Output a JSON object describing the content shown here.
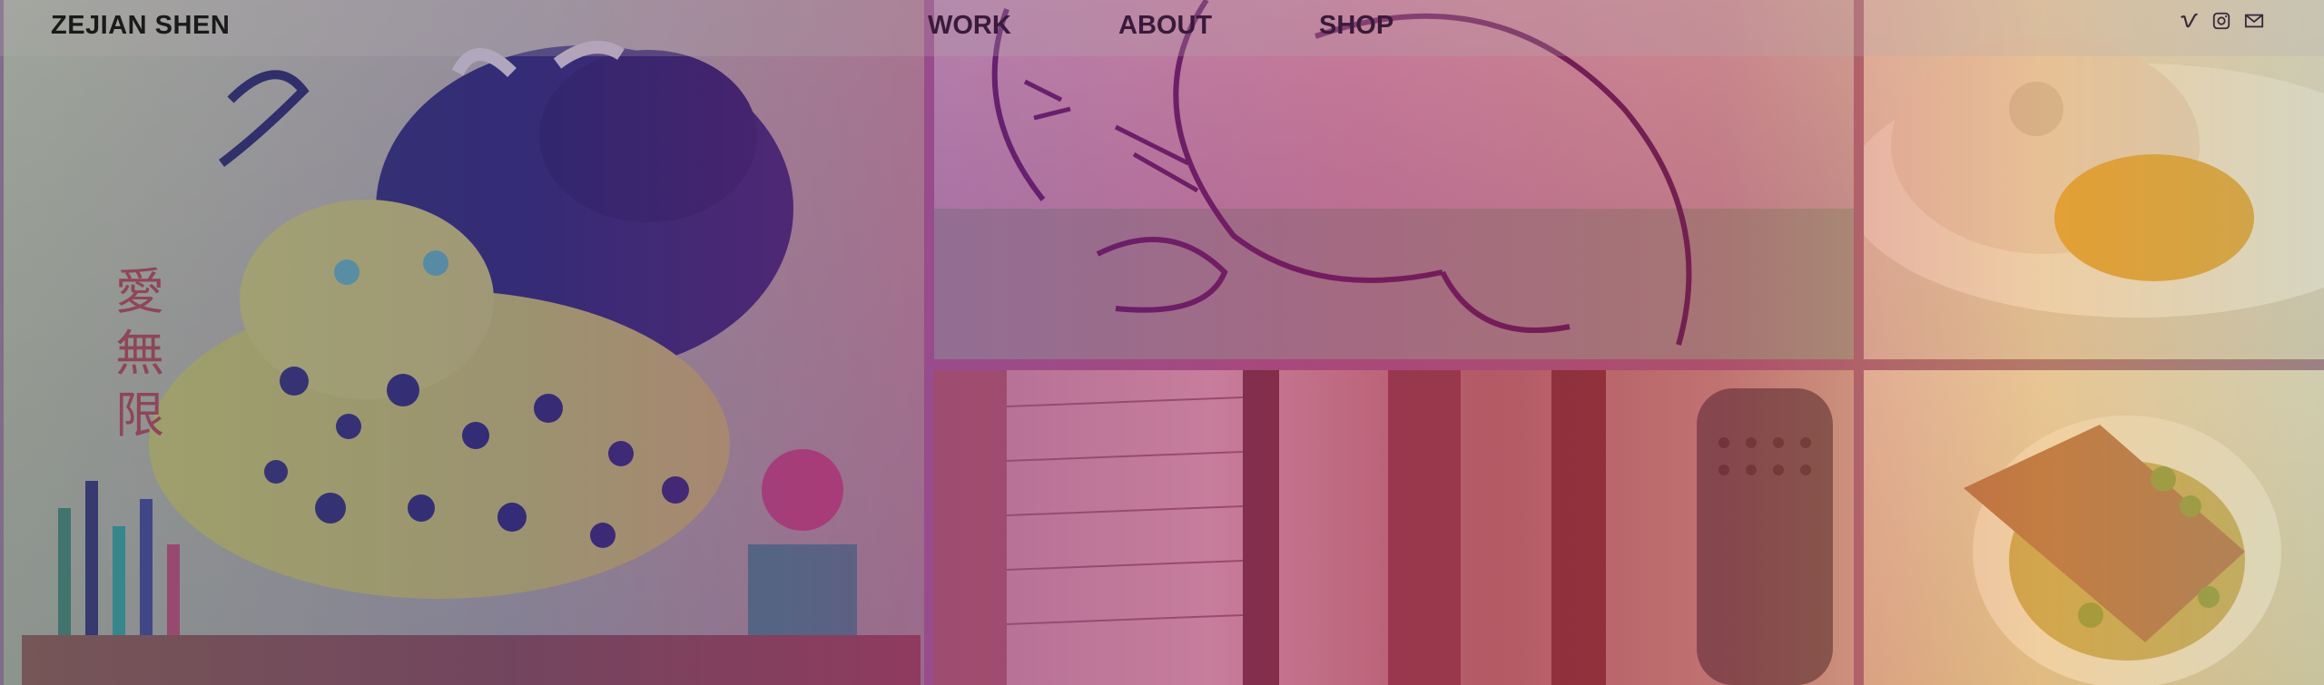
{
  "header": {
    "logo": "ZEJIAN SHEN",
    "nav": [
      {
        "label": "WORK"
      },
      {
        "label": "ABOUT"
      },
      {
        "label": "SHOP"
      }
    ],
    "social": [
      {
        "icon": "vimeo-icon"
      },
      {
        "icon": "instagram-icon"
      },
      {
        "icon": "email-icon"
      }
    ]
  },
  "tiles": {
    "left": {
      "poster_text": "愛無限"
    }
  },
  "colors": {
    "overlay_left": "#6e5aa0",
    "overlay_mid": "#b02890",
    "overlay_right": "#e09a30"
  }
}
